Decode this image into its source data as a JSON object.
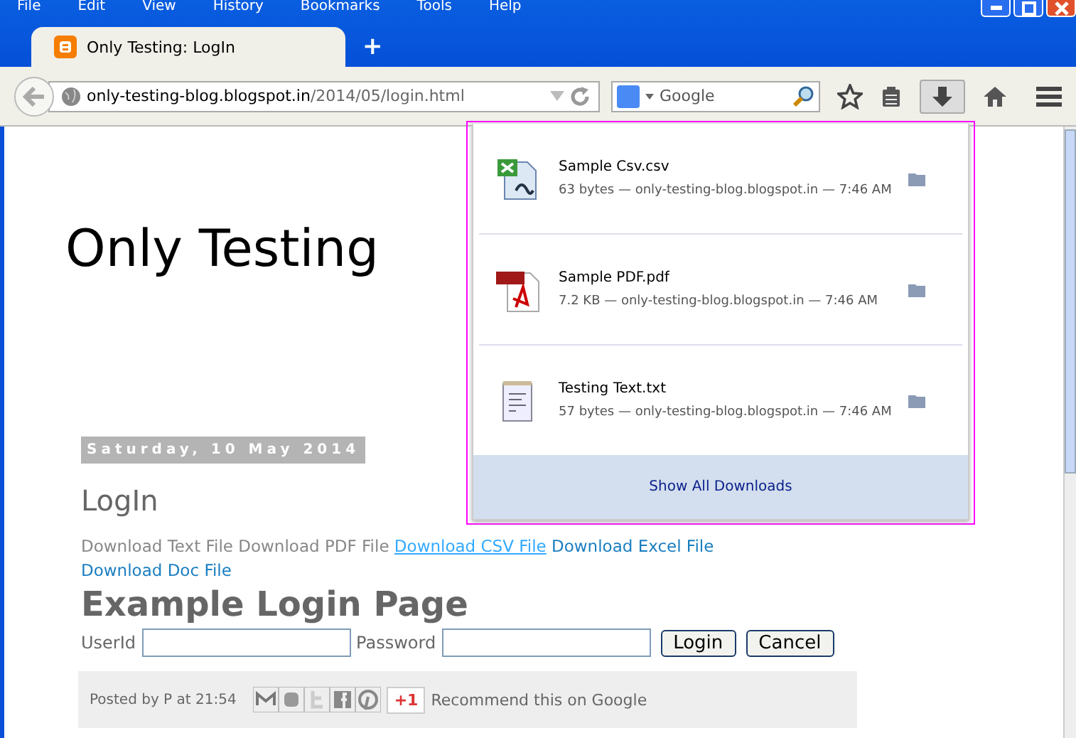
{
  "menu_bar": [
    "File",
    "Edit",
    "View",
    "History",
    "Bookmarks",
    "Tools",
    "Help"
  ],
  "tabs": [
    {
      "label": "Only Testing: LogIn",
      "selected": true
    }
  ],
  "new_tab": "+",
  "address_bar": {
    "host": "only-testing-blog.blogspot.in",
    "path": "/2014/05/login.html"
  },
  "search": {
    "placeholder": "Google"
  },
  "downloads_panel": {
    "items": [
      {
        "kind": "spreadsheet",
        "name": "Sample Csv.csv",
        "details": "63 bytes — only-testing-blog.blogspot.in — 7:46 AM"
      },
      {
        "kind": "pdf",
        "name": "Sample PDF.pdf",
        "details": "7.2 KB — only-testing-blog.blogspot.in — 7:46 AM"
      },
      {
        "kind": "text",
        "name": "Testing Text.txt",
        "details": "57 bytes — only-testing-blog.blogspot.in — 7:46 AM"
      }
    ],
    "footer_link": "Show All Downloads"
  },
  "page": {
    "blog_title": "Only Testing",
    "date_header": "Saturday, 10 May 2014",
    "post_title": "LogIn",
    "links": [
      {
        "label": "Download Text File",
        "kind": "visited"
      },
      {
        "label": "Download PDF File",
        "kind": "visited"
      },
      {
        "label": "Download CSV File",
        "kind": "hovered"
      },
      {
        "label": "Download Excel File",
        "kind": "link"
      },
      {
        "label": "Download Doc File",
        "kind": "link"
      }
    ],
    "heading": "Example Login Page",
    "form": {
      "userid_label": "UserId",
      "password_label": "Password",
      "buttons": [
        "Login",
        "Cancel"
      ]
    },
    "footer": {
      "posted_by": "Posted by P at 21:54",
      "plus_one": "+1",
      "recommend": "Recommend this on Google"
    }
  }
}
